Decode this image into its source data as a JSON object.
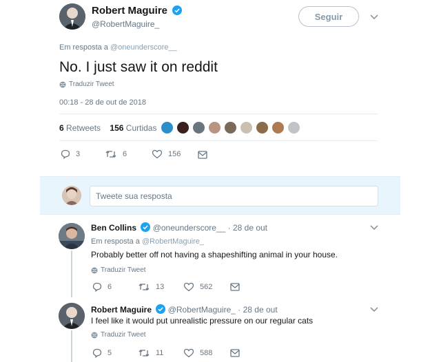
{
  "main_tweet": {
    "author_name": "Robert Maguire",
    "author_handle": "@RobertMaguire_",
    "follow_label": "Seguir",
    "in_reply_prefix": "Em resposta a",
    "in_reply_to": "@oneunderscore__",
    "text": "No. I just saw it on reddit",
    "translate_label": "Traduzir Tweet",
    "timestamp": "00:18 - 28 de out de 2018",
    "retweets_count": "6",
    "retweets_label": "Retweets",
    "likes_count": "156",
    "likes_label": "Curtidas",
    "liker_colors": [
      "#2c8fc9",
      "#3a1f1f",
      "#6b7580",
      "#b89580",
      "#7a6a5a",
      "#c9c0b0",
      "#8a6b4a",
      "#b07a50",
      "#c0c4c8"
    ],
    "actions": {
      "reply_count": "3",
      "retweet_count": "6",
      "like_count": "156"
    }
  },
  "reply_composer": {
    "placeholder": "Tweete sua resposta"
  },
  "replies": [
    {
      "author_name": "Ben Collins",
      "author_handle": "@oneunderscore__",
      "date": "· 28 de out",
      "in_reply_prefix": "Em resposta a",
      "in_reply_to": "@RobertMaguire_",
      "text": "Probably better off not having a shapeshifting animal in your house.",
      "translate_label": "Traduzir Tweet",
      "reply_count": "6",
      "retweet_count": "13",
      "like_count": "562"
    },
    {
      "author_name": "Robert Maguire",
      "author_handle": "@RobertMaguire_",
      "date": "· 28 de out",
      "text": "I feel like it would put unrealistic pressure on our regular cats",
      "translate_label": "Traduzir Tweet",
      "reply_count": "5",
      "retweet_count": "11",
      "like_count": "588"
    }
  ],
  "colors": {
    "verified": "#1da1f2",
    "link": "#1da1f2",
    "secondary_text": "#657786"
  }
}
